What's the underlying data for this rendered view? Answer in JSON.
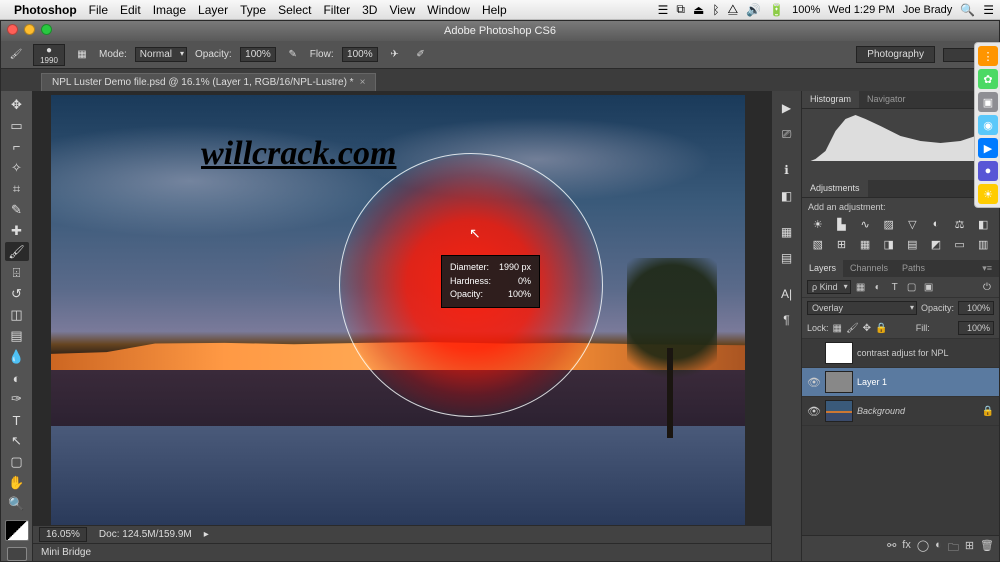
{
  "menubar": {
    "app": "Photoshop",
    "items": [
      "File",
      "Edit",
      "Image",
      "Layer",
      "Type",
      "Select",
      "Filter",
      "3D",
      "View",
      "Window",
      "Help"
    ],
    "battery": "100%",
    "clock": "Wed 1:29 PM",
    "user": "Joe Brady"
  },
  "window": {
    "title": "Adobe Photoshop CS6"
  },
  "options": {
    "brush_size": "1990",
    "mode_label": "Mode:",
    "mode_value": "Normal",
    "opacity_label": "Opacity:",
    "opacity_value": "100%",
    "flow_label": "Flow:",
    "flow_value": "100%",
    "workspace_btn": "Photography"
  },
  "doc_tab": "NPL Luster Demo file.psd @ 16.1% (Layer 1, RGB/16/NPL-Lustre) *",
  "watermark": "willcrack.com",
  "brush_tooltip": {
    "r1l": "Diameter:",
    "r1v": "1990 px",
    "r2l": "Hardness:",
    "r2v": "0%",
    "r3l": "Opacity:",
    "r3v": "100%"
  },
  "status": {
    "zoom": "16.05%",
    "doc": "Doc: 124.5M/159.9M"
  },
  "mini_bridge": "Mini Bridge",
  "panels": {
    "hist_tab": "Histogram",
    "nav_tab": "Navigator",
    "adj_tab": "Adjustments",
    "adj_label": "Add an adjustment:",
    "layers_tab": "Layers",
    "channels_tab": "Channels",
    "paths_tab": "Paths",
    "filter_kind": "ρ Kind",
    "blend_mode": "Overlay",
    "opacity_label": "Opacity:",
    "opacity_value": "100%",
    "lock_label": "Lock:",
    "fill_label": "Fill:",
    "fill_value": "100%",
    "layer0": "contrast adjust for NPL",
    "layer1": "Layer 1",
    "layer2": "Background"
  }
}
